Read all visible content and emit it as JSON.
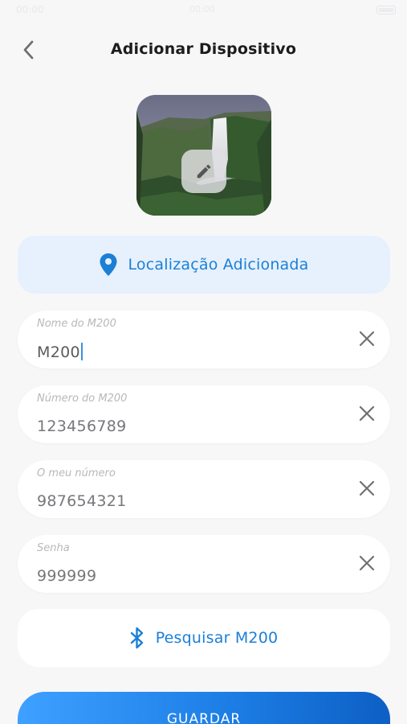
{
  "status_bar": {
    "time": "00:00",
    "center": "00:00"
  },
  "header": {
    "title": "Adicionar Dispositivo",
    "back_icon": "chevron-left-icon"
  },
  "photo": {
    "edit_icon": "pencil-icon"
  },
  "location": {
    "label": "Localização Adicionada",
    "icon": "location-pin-icon",
    "color": "#1b7fd6"
  },
  "fields": [
    {
      "label": "Nome do M200",
      "value": "M200"
    },
    {
      "label": "Número do M200",
      "value": "123456789"
    },
    {
      "label": "O meu número",
      "value": "987654321"
    },
    {
      "label": "Senha",
      "value": "999999"
    }
  ],
  "bluetooth": {
    "label": "Pesquisar M200",
    "icon": "bluetooth-icon"
  },
  "save": {
    "label": "GUARDAR"
  },
  "colors": {
    "accent": "#1b7fd6",
    "background": "#f7f7f8",
    "location_bg": "#e6f1fd"
  }
}
